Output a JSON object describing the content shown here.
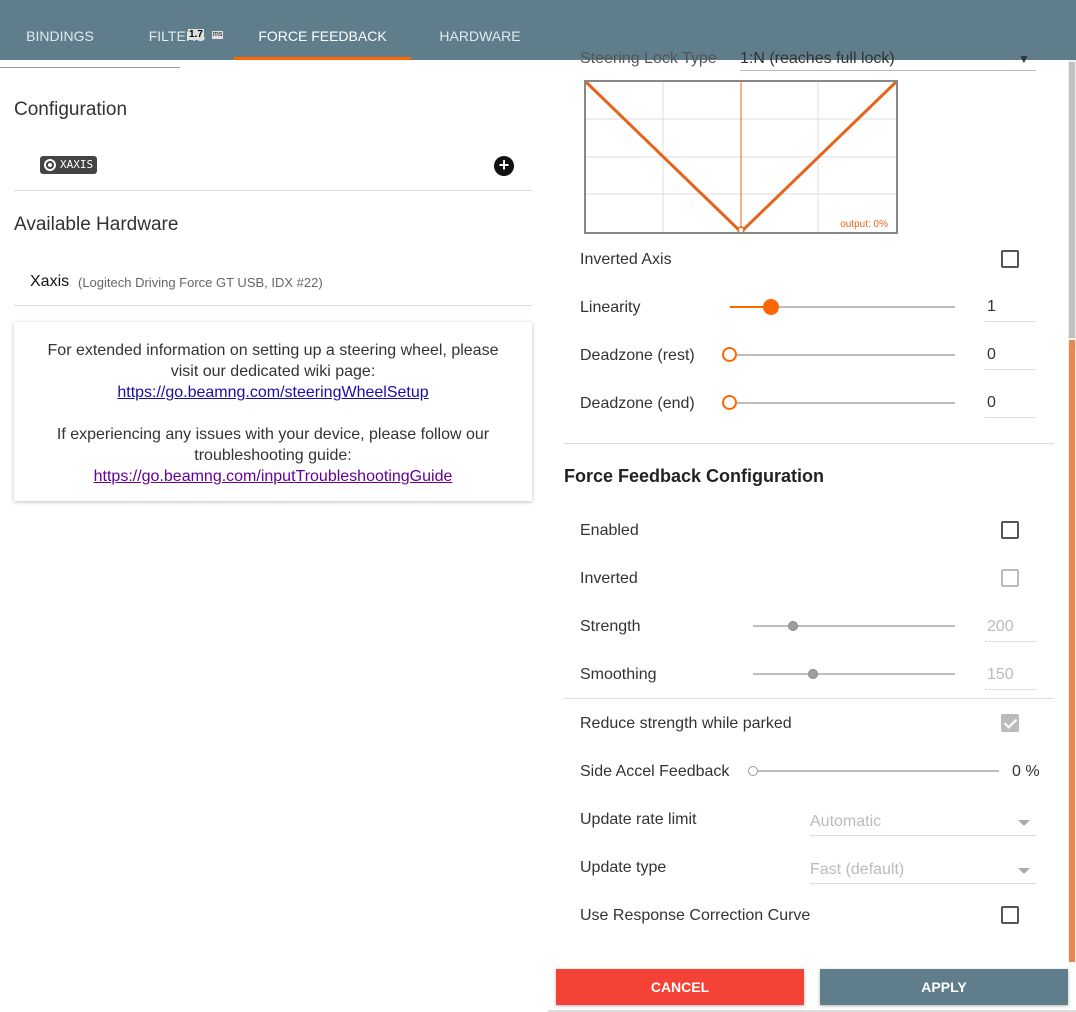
{
  "tabs": [
    {
      "label": "BINDINGS",
      "active": false
    },
    {
      "label": "FILTERS",
      "active": false
    },
    {
      "label": "FORCE FEEDBACK",
      "active": true
    },
    {
      "label": "HARDWARE",
      "active": false
    }
  ],
  "fps_overlay": {
    "value": "1.7",
    "unit": "ms"
  },
  "left": {
    "configuration_title": "Configuration",
    "configuration_chip": "XAXIS",
    "available_hardware_title": "Available Hardware",
    "hardware_name": "Xaxis",
    "hardware_detail": "(Logitech Driving Force GT USB, IDX #22)",
    "info": {
      "line1": "For extended information on setting up a steering wheel, please visit our dedicated wiki page:",
      "link1": "https://go.beamng.com/steeringWheelSetup",
      "line2": "If experiencing any issues with your device, please follow our troubleshooting guide:",
      "link2": "https://go.beamng.com/inputTroubleshootingGuide"
    }
  },
  "right": {
    "steering_lock": {
      "label": "Steering Lock Type",
      "value": "1:N (reaches full lock)"
    },
    "graph_output": "output: 0%",
    "inverted_axis": {
      "label": "Inverted Axis",
      "checked": false
    },
    "linearity": {
      "label": "Linearity",
      "value": "1",
      "level": 0.18
    },
    "deadzone_rest": {
      "label": "Deadzone (rest)",
      "value": "0",
      "level": 0
    },
    "deadzone_end": {
      "label": "Deadzone (end)",
      "value": "0",
      "level": 0
    },
    "ffb_title": "Force Feedback Configuration",
    "enabled": {
      "label": "Enabled",
      "checked": false
    },
    "inverted": {
      "label": "Inverted",
      "checked": false,
      "disabled": true
    },
    "strength": {
      "label": "Strength",
      "value": "200",
      "level": 0.2
    },
    "smoothing": {
      "label": "Smoothing",
      "value": "150",
      "level": 0.3
    },
    "reduce_parked": {
      "label": "Reduce strength while parked",
      "checked": true,
      "disabled": true
    },
    "side_accel": {
      "label": "Side Accel Feedback",
      "value": "0 %",
      "level": 0
    },
    "update_rate": {
      "label": "Update rate limit",
      "value": "Automatic"
    },
    "update_type": {
      "label": "Update type",
      "value": "Fast (default)"
    },
    "response_curve": {
      "label": "Use Response Correction Curve",
      "checked": false
    }
  },
  "buttons": {
    "cancel": "CANCEL",
    "apply": "APPLY"
  },
  "colors": {
    "accent": "#ff6600",
    "toolbar": "#607d8b",
    "cancel": "#f44336"
  }
}
